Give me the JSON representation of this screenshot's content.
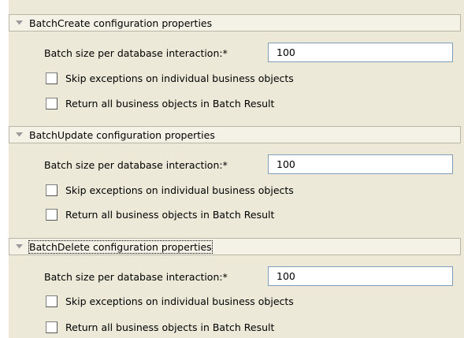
{
  "sections": [
    {
      "title": "BatchCreate configuration properties",
      "batch_size_label": "Batch size per database interaction:*",
      "batch_size_value": "100",
      "skip_exceptions_label": "Skip exceptions on individual business objects",
      "skip_exceptions_checked": false,
      "return_all_label": "Return all business objects in Batch Result",
      "return_all_checked": false,
      "expanded": true
    },
    {
      "title": "BatchUpdate configuration properties",
      "batch_size_label": "Batch size per database interaction:*",
      "batch_size_value": "100",
      "skip_exceptions_label": "Skip exceptions on individual business objects",
      "skip_exceptions_checked": false,
      "return_all_label": "Return all business objects in Batch Result",
      "return_all_checked": false,
      "expanded": true
    },
    {
      "title": "BatchDelete configuration properties",
      "batch_size_label": "Batch size per database interaction:*",
      "batch_size_value": "100",
      "skip_exceptions_label": "Skip exceptions on individual business objects",
      "skip_exceptions_checked": false,
      "return_all_label": "Return all business objects in Batch Result",
      "return_all_checked": false,
      "expanded": true,
      "focused": true
    }
  ],
  "colors": {
    "panel_background": "#ece9d8",
    "header_background": "#f4f2e6",
    "input_border": "#7f9db9",
    "chevron": "#9b9b9b"
  },
  "icons": {
    "section_toggle": "chevron-down-icon"
  }
}
